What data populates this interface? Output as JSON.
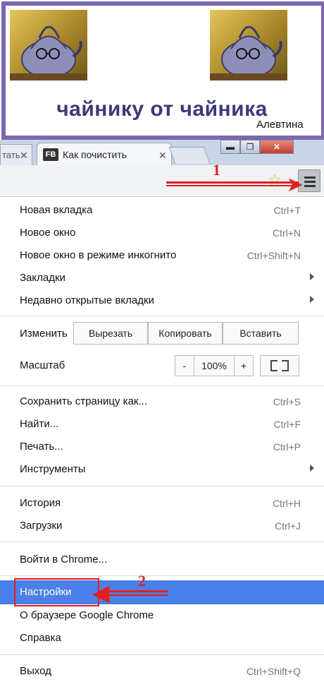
{
  "banner": {
    "title": "чайнику от чайника",
    "author": "Алевтина",
    "frame_color": "#7b68ae"
  },
  "tabs": {
    "prev_tab_title": "тать",
    "active_tab_icon": "FB",
    "active_tab_title": "Как почистить",
    "close_glyph": "✕"
  },
  "window_controls": {
    "minimize": "▬",
    "maximize": "❐",
    "close": "✕"
  },
  "toolbar": {
    "bookmark_icon": "star-icon",
    "menu_icon": "hamburger-menu-icon"
  },
  "annotations": {
    "step1": "1",
    "step2": "2",
    "color": "#e02020"
  },
  "menu": {
    "items_top": [
      {
        "label": "Новая вкладка",
        "shortcut": "Ctrl+T"
      },
      {
        "label": "Новое окно",
        "shortcut": "Ctrl+N"
      },
      {
        "label": "Новое окно в режиме инкогнито",
        "shortcut": "Ctrl+Shift+N"
      },
      {
        "label": "Закладки",
        "submenu": true
      },
      {
        "label": "Недавно открытые вкладки",
        "submenu": true
      }
    ],
    "edit": {
      "label": "Изменить",
      "cut": "Вырезать",
      "copy": "Копировать",
      "paste": "Вставить"
    },
    "zoom": {
      "label": "Масштаб",
      "minus": "-",
      "value": "100%",
      "plus": "+"
    },
    "items_page": [
      {
        "label": "Сохранить страницу как...",
        "shortcut": "Ctrl+S"
      },
      {
        "label": "Найти...",
        "shortcut": "Ctrl+F"
      },
      {
        "label": "Печать...",
        "shortcut": "Ctrl+P"
      },
      {
        "label": "Инструменты",
        "submenu": true
      }
    ],
    "items_history": [
      {
        "label": "История",
        "shortcut": "Ctrl+H"
      },
      {
        "label": "Загрузки",
        "shortcut": "Ctrl+J"
      }
    ],
    "signin": "Войти в Chrome...",
    "items_settings": [
      {
        "label": "Настройки",
        "highlighted": true
      },
      {
        "label": "О браузере Google Chrome"
      },
      {
        "label": "Справка"
      }
    ],
    "exit": {
      "label": "Выход",
      "shortcut": "Ctrl+Shift+Q"
    },
    "highlight_color": "#4a80e8"
  }
}
